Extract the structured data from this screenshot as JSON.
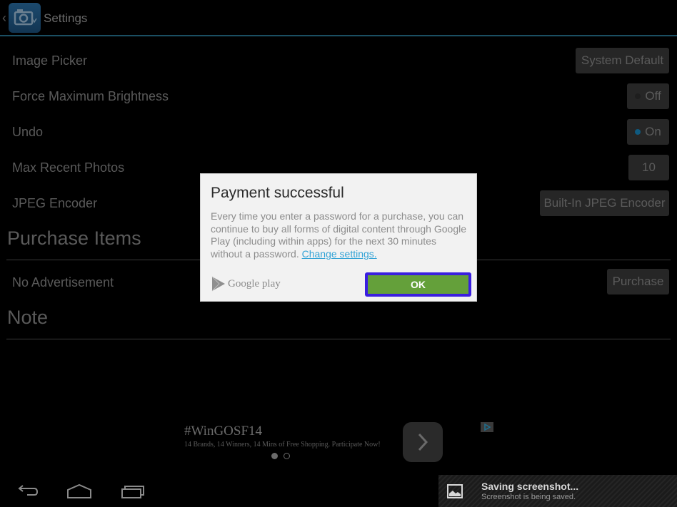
{
  "action_bar": {
    "title": "Settings",
    "icon": "camera-app-icon"
  },
  "settings": [
    {
      "label": "Image Picker",
      "value": "System Default",
      "type": "button"
    },
    {
      "label": "Force Maximum Brightness",
      "value": "Off",
      "type": "toggle",
      "on": false
    },
    {
      "label": "Undo",
      "value": "On",
      "type": "toggle",
      "on": true
    },
    {
      "label": "Max Recent Photos",
      "value": "10",
      "type": "button"
    },
    {
      "label": "JPEG Encoder",
      "value": "Built-In JPEG Encoder",
      "type": "button"
    }
  ],
  "sections": {
    "purchase_items": "Purchase Items",
    "note": "Note"
  },
  "purchase": {
    "label": "No Advertisement",
    "button": "Purchase"
  },
  "dialog": {
    "title": "Payment successful",
    "body": "Every time you enter a password for a purchase, you can continue to buy all forms of digital content through Google Play (including within apps) for the next 30 minutes without a password. ",
    "link": "Change settings.",
    "brand": "Google play",
    "ok": "OK"
  },
  "ad": {
    "title": "#WinGOSF14",
    "subtitle": "14 Brands, 14 Winners, 14 Mins of Free Shopping. Participate Now!",
    "page_count": 2,
    "active_page": 1
  },
  "notification": {
    "title": "Saving screenshot...",
    "subtitle": "Screenshot is being saved."
  },
  "colors": {
    "accent_underline": "#1b4f63",
    "toggle_on": "#0f5a80",
    "ok_button": "#64a03a",
    "focus_ring": "#3a1fe0",
    "link": "#33a3d6"
  }
}
